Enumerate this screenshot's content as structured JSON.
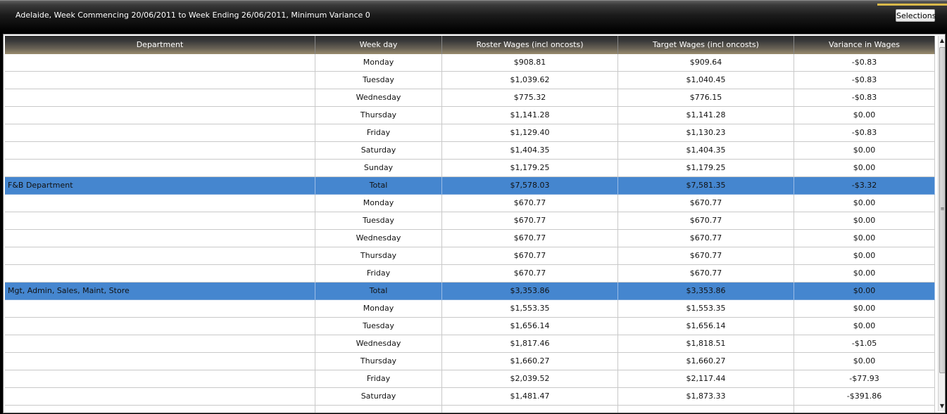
{
  "header": {
    "title": "Adelaide, Week Commencing 20/06/2011 to Week Ending 26/06/2011, Minimum Variance 0",
    "selections_label": "Selections"
  },
  "colors": {
    "total_row": "#4586cf",
    "accent": "#d9b94a"
  },
  "grid": {
    "columns": [
      "Department",
      "Week day",
      "Roster Wages (incl oncosts)",
      "Target Wages (incl oncosts)",
      "Variance in Wages"
    ],
    "rows": [
      {
        "dept": "",
        "day": "Monday",
        "roster": "$908.81",
        "target": "$909.64",
        "variance": "-$0.83",
        "total": false
      },
      {
        "dept": "",
        "day": "Tuesday",
        "roster": "$1,039.62",
        "target": "$1,040.45",
        "variance": "-$0.83",
        "total": false
      },
      {
        "dept": "",
        "day": "Wednesday",
        "roster": "$775.32",
        "target": "$776.15",
        "variance": "-$0.83",
        "total": false
      },
      {
        "dept": "",
        "day": "Thursday",
        "roster": "$1,141.28",
        "target": "$1,141.28",
        "variance": "$0.00",
        "total": false
      },
      {
        "dept": "",
        "day": "Friday",
        "roster": "$1,129.40",
        "target": "$1,130.23",
        "variance": "-$0.83",
        "total": false
      },
      {
        "dept": "",
        "day": "Saturday",
        "roster": "$1,404.35",
        "target": "$1,404.35",
        "variance": "$0.00",
        "total": false
      },
      {
        "dept": "",
        "day": "Sunday",
        "roster": "$1,179.25",
        "target": "$1,179.25",
        "variance": "$0.00",
        "total": false
      },
      {
        "dept": "F&B Department",
        "day": "Total",
        "roster": "$7,578.03",
        "target": "$7,581.35",
        "variance": "-$3.32",
        "total": true
      },
      {
        "dept": "",
        "day": "Monday",
        "roster": "$670.77",
        "target": "$670.77",
        "variance": "$0.00",
        "total": false
      },
      {
        "dept": "",
        "day": "Tuesday",
        "roster": "$670.77",
        "target": "$670.77",
        "variance": "$0.00",
        "total": false
      },
      {
        "dept": "",
        "day": "Wednesday",
        "roster": "$670.77",
        "target": "$670.77",
        "variance": "$0.00",
        "total": false
      },
      {
        "dept": "",
        "day": "Thursday",
        "roster": "$670.77",
        "target": "$670.77",
        "variance": "$0.00",
        "total": false
      },
      {
        "dept": "",
        "day": "Friday",
        "roster": "$670.77",
        "target": "$670.77",
        "variance": "$0.00",
        "total": false
      },
      {
        "dept": "Mgt, Admin, Sales, Maint, Store",
        "day": "Total",
        "roster": "$3,353.86",
        "target": "$3,353.86",
        "variance": "$0.00",
        "total": true
      },
      {
        "dept": "",
        "day": "Monday",
        "roster": "$1,553.35",
        "target": "$1,553.35",
        "variance": "$0.00",
        "total": false
      },
      {
        "dept": "",
        "day": "Tuesday",
        "roster": "$1,656.14",
        "target": "$1,656.14",
        "variance": "$0.00",
        "total": false
      },
      {
        "dept": "",
        "day": "Wednesday",
        "roster": "$1,817.46",
        "target": "$1,818.51",
        "variance": "-$1.05",
        "total": false
      },
      {
        "dept": "",
        "day": "Thursday",
        "roster": "$1,660.27",
        "target": "$1,660.27",
        "variance": "$0.00",
        "total": false
      },
      {
        "dept": "",
        "day": "Friday",
        "roster": "$2,039.52",
        "target": "$2,117.44",
        "variance": "-$77.93",
        "total": false
      },
      {
        "dept": "",
        "day": "Saturday",
        "roster": "$1,481.47",
        "target": "$1,873.33",
        "variance": "-$391.86",
        "total": false
      },
      {
        "dept": "",
        "day": "",
        "roster": "",
        "target": "",
        "variance": "",
        "total": false
      }
    ]
  },
  "scrollbar": {
    "up_icon": "scroll-up-arrow-icon",
    "down_icon": "scroll-down-arrow-icon",
    "grip_icon": "scroll-grip-icon",
    "position_fraction": 0.0
  }
}
